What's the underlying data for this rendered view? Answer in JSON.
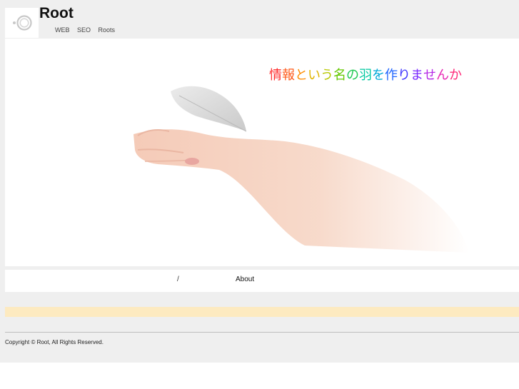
{
  "header": {
    "site_title": "Root",
    "tagline": "WEB SEO Roots"
  },
  "hero": {
    "headline_chars": [
      "情",
      "報",
      "と",
      "い",
      "う",
      "名",
      "の",
      "羽",
      "を",
      "作",
      "り",
      "ま",
      "せ",
      "ん",
      "か"
    ],
    "headline_colors": [
      "#ff2a2a",
      "#ff5a1a",
      "#ff8c00",
      "#e0b400",
      "#b8c800",
      "#64c800",
      "#1ec850",
      "#00c8a0",
      "#00a8d8",
      "#1e64ff",
      "#3c32ff",
      "#7a28ff",
      "#b428e6",
      "#e628b4",
      "#ff2878"
    ]
  },
  "nav": {
    "separator": "/",
    "about_label": "About"
  },
  "footer": {
    "copyright": "Copyright © Root, All Rights Reserved."
  },
  "colors": {
    "page_background": "#efefef",
    "notice_bar": "#fdeac0"
  }
}
